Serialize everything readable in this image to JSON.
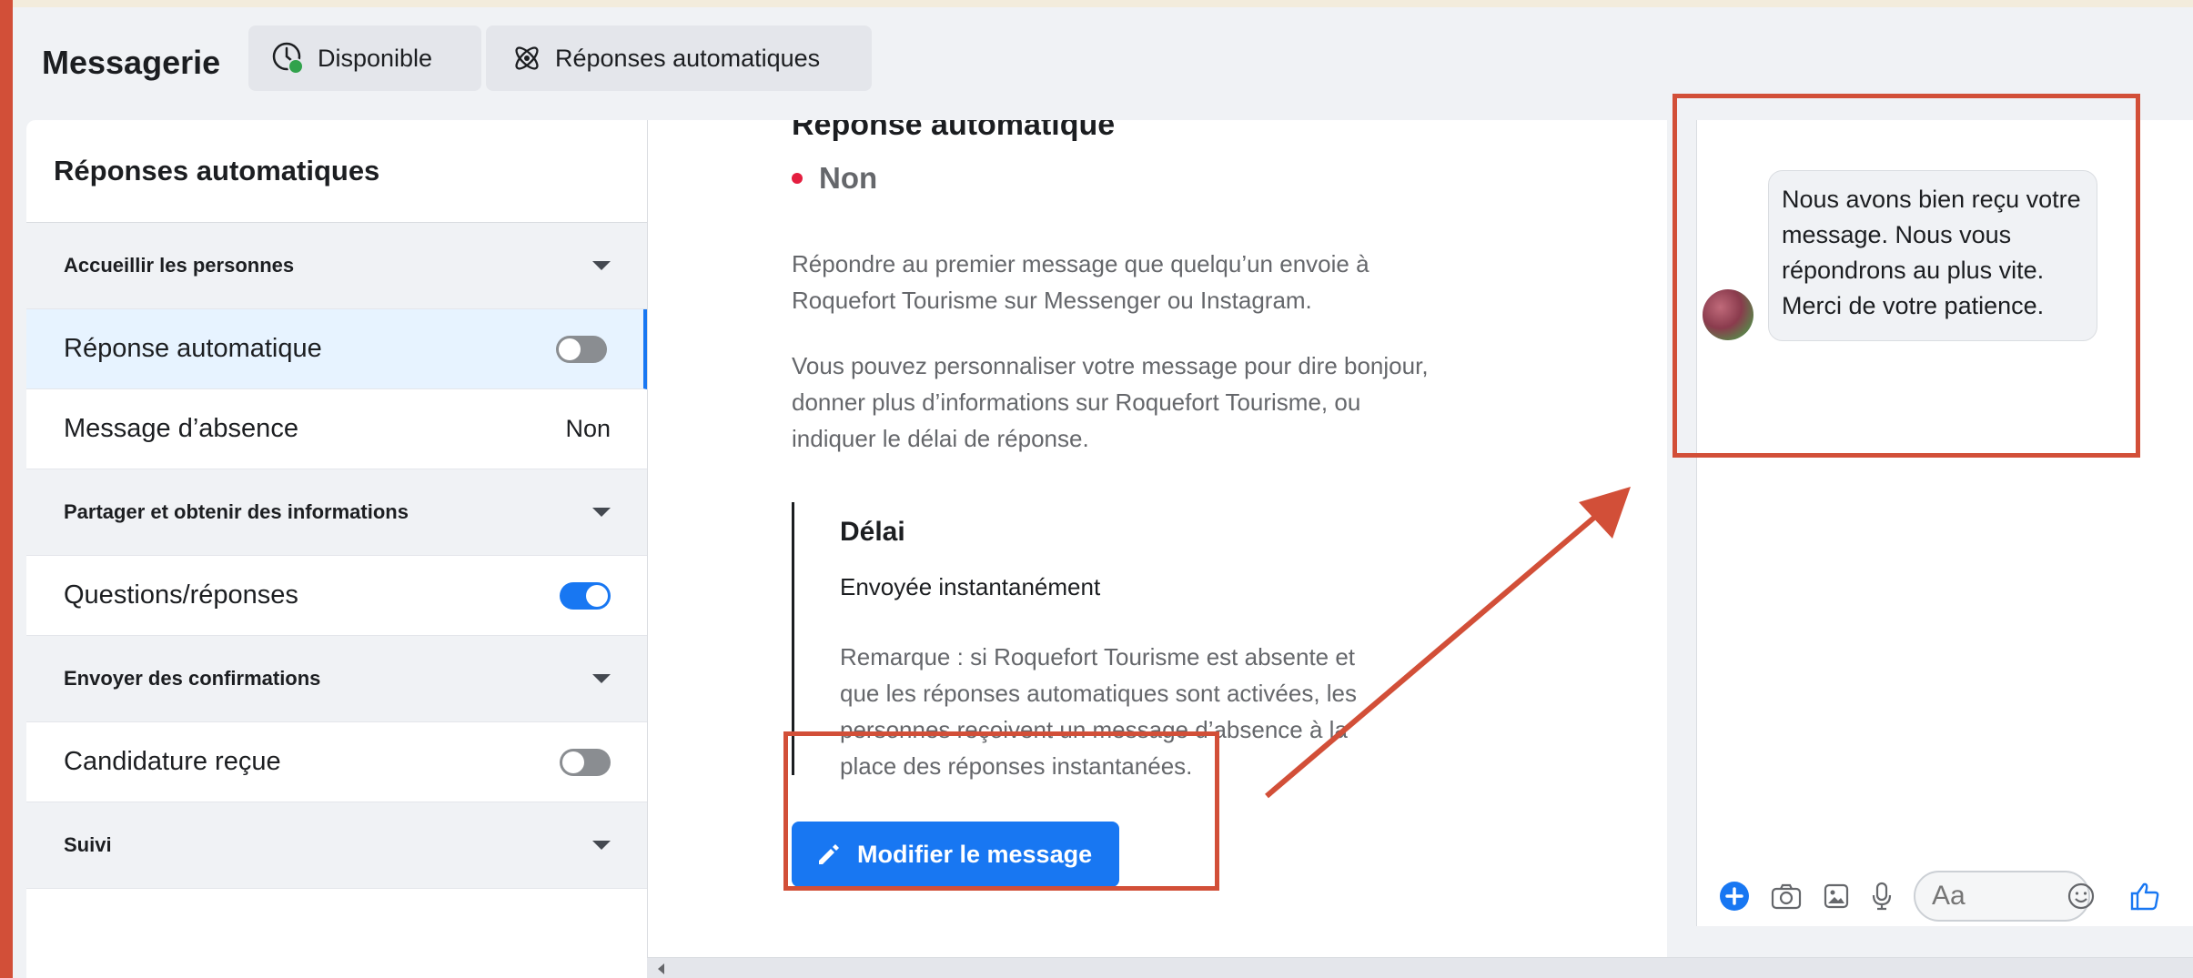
{
  "header": {
    "title": "Messagerie",
    "status_label": "Disponible",
    "auto_label": "Réponses automatiques"
  },
  "sidebar": {
    "title": "Réponses automatiques",
    "items": [
      {
        "type": "section",
        "label": "Accueillir les personnes"
      },
      {
        "type": "toggle",
        "label": "Réponse automatique",
        "state": "off",
        "active": true
      },
      {
        "type": "value",
        "label": "Message d’absence",
        "value": "Non"
      },
      {
        "type": "section",
        "label": "Partager et obtenir des informations"
      },
      {
        "type": "toggle",
        "label": "Questions/réponses",
        "state": "on"
      },
      {
        "type": "section",
        "label": "Envoyer des confirmations"
      },
      {
        "type": "toggle",
        "label": "Candidature reçue",
        "state": "off"
      },
      {
        "type": "section",
        "label": "Suivi"
      }
    ]
  },
  "main": {
    "title": "Réponse automatique",
    "status": "Non",
    "paragraph1": "Répondre au premier message que quelqu’un envoie à Roquefort Tourisme sur Messenger ou Instagram.",
    "paragraph2": "Vous pouvez personnaliser votre message pour dire bonjour, donner plus d’informations sur Roquefort Tourisme, ou indiquer le délai de réponse.",
    "delay_title": "Délai",
    "delay_value": "Envoyée instantanément",
    "note": "Remarque : si Roquefort Tourisme est absente et que les réponses automatiques sont activées, les personnes reçoivent un message d’absence à la place des réponses instantanées.",
    "edit_button": "Modifier le message"
  },
  "preview": {
    "message": "Nous avons bien reçu votre message. Nous vous répondrons au plus vite. Merci de votre patience.",
    "input_placeholder": "Aa"
  },
  "colors": {
    "accent": "#1877f2",
    "annotation": "#d24f38",
    "status_dot": "#e41e3f"
  }
}
